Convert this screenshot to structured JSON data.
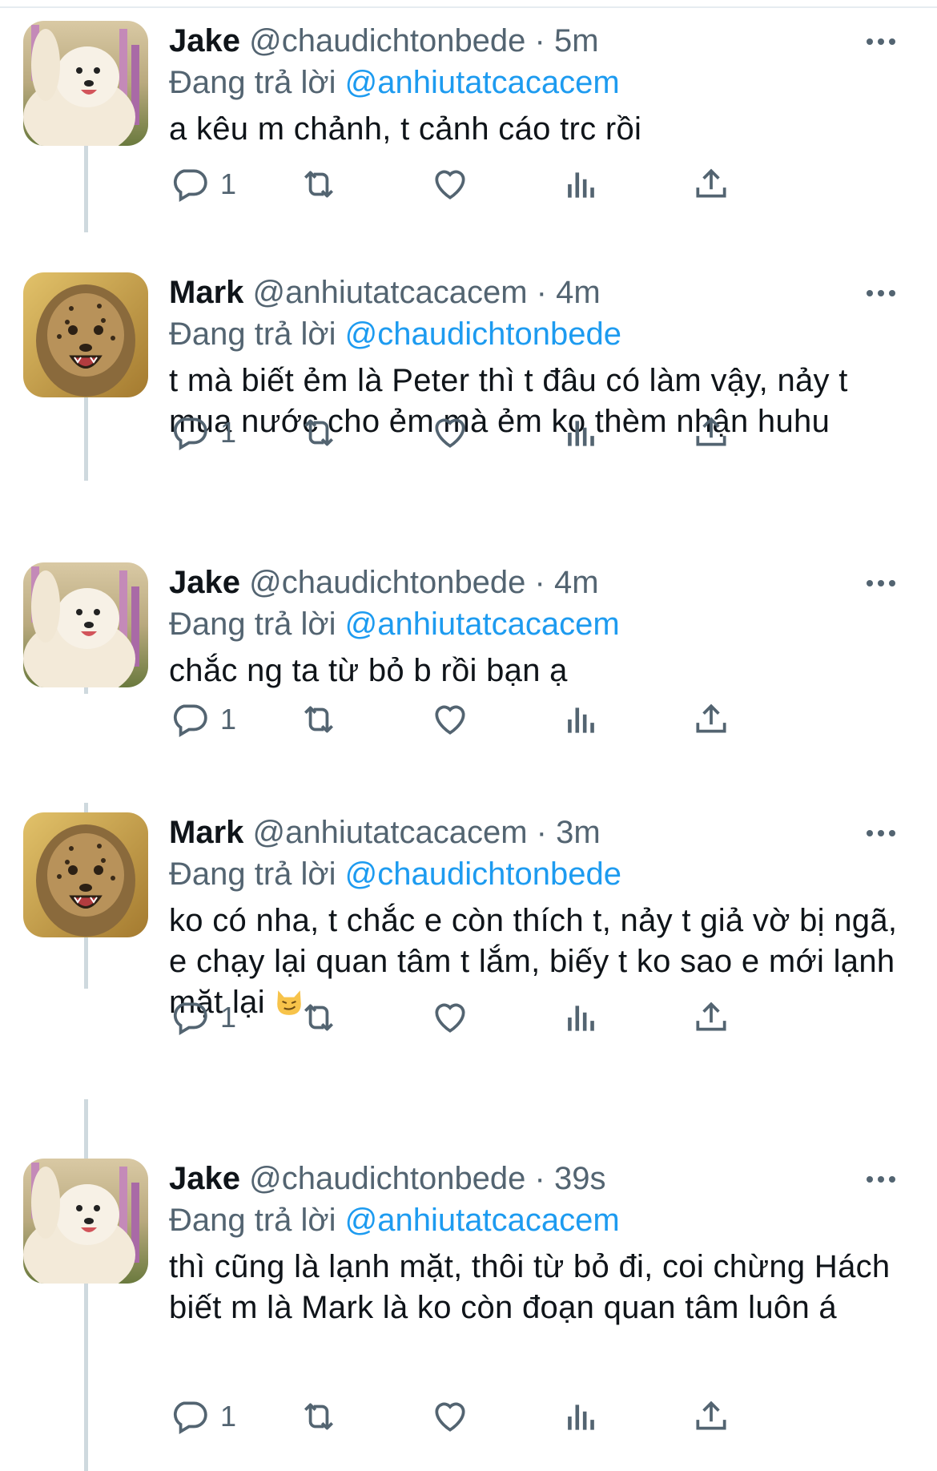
{
  "reply_prefix": "Đang trả lời",
  "tweets": [
    {
      "name": "Jake",
      "handle": "@chaudichtonbede",
      "time": "5m",
      "reply_to": "@anhiutatcacacem",
      "text": "a kêu m chảnh, t cảnh cáo trc rồi",
      "reply_count": "1",
      "avatar": "samoyed-dog-avatar"
    },
    {
      "name": "Mark",
      "handle": "@anhiutatcacacem",
      "time": "4m",
      "reply_to": "@chaudichtonbede",
      "text": "t mà biết ẻm là Peter thì t đâu có làm vậy, nảy t mua nước cho ẻm mà ẻm ko thèm nhận huhu",
      "reply_count": "1",
      "avatar": "cheetah-cub-avatar"
    },
    {
      "name": "Jake",
      "handle": "@chaudichtonbede",
      "time": "4m",
      "reply_to": "@anhiutatcacacem",
      "text": "chắc ng ta từ bỏ b rồi bạn ạ",
      "reply_count": "1",
      "avatar": "samoyed-dog-avatar"
    },
    {
      "name": "Mark",
      "handle": "@anhiutatcacacem",
      "time": "3m",
      "reply_to": "@chaudichtonbede",
      "text": "ko có nha, t chắc e còn thích t, nảy t giả vờ bị ngã, e chạy lại quan tâm t lắm, biếy t ko sao e mới lạnh mặt lại",
      "reply_count": "1",
      "avatar": "cheetah-cub-avatar",
      "emoji": "smirking-cat-emoji"
    },
    {
      "name": "Jake",
      "handle": "@chaudichtonbede",
      "time": "39s",
      "reply_to": "@anhiutatcacacem",
      "text": "thì cũng là lạnh mặt, thôi từ bỏ đi, coi chừng Hách biết m là Mark là ko còn đoạn quan tâm luôn á",
      "reply_count": "1",
      "avatar": "samoyed-dog-avatar"
    }
  ],
  "colors": {
    "link": "#1d9bf0",
    "secondary": "#536471",
    "thread_line": "#cfd9de"
  },
  "icons": [
    "reply-icon",
    "retweet-icon",
    "like-icon",
    "views-icon",
    "share-icon",
    "more-icon"
  ]
}
